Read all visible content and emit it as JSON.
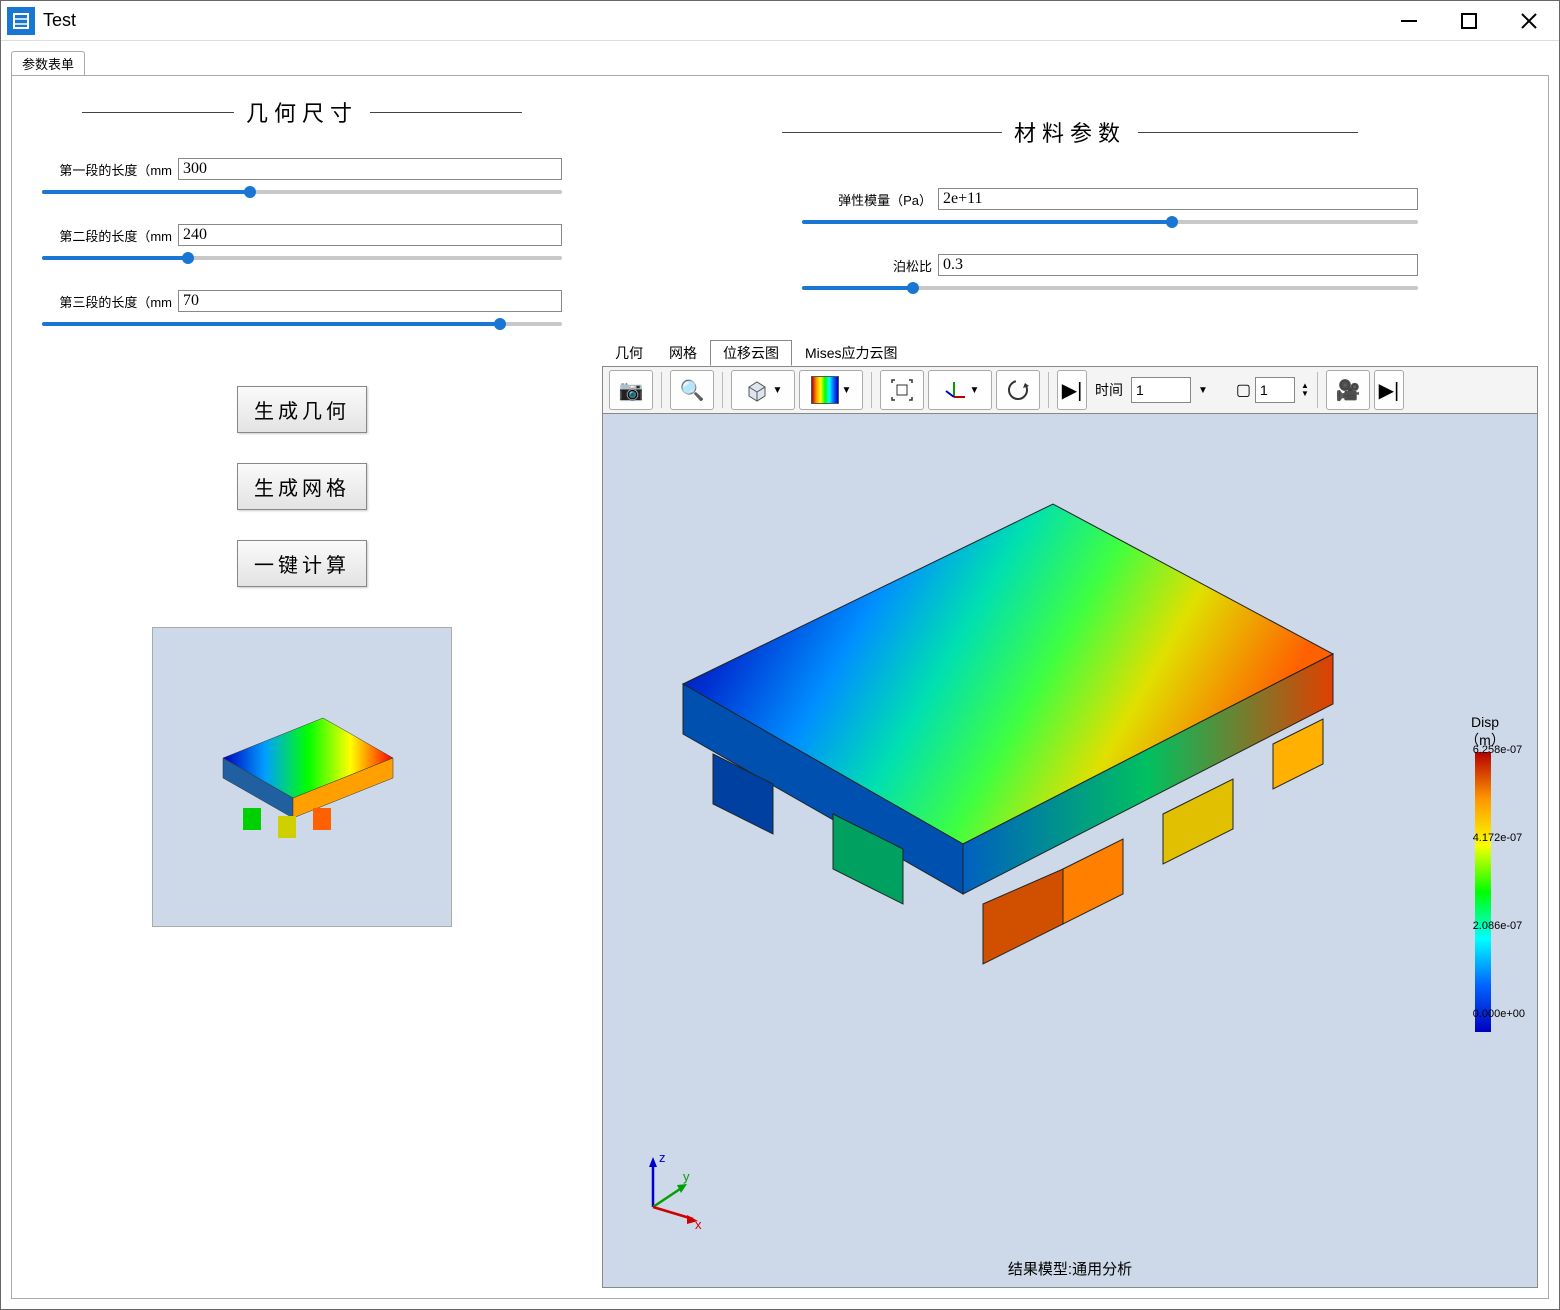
{
  "window": {
    "title": "Test"
  },
  "main_tab": "参数表单",
  "geometry_section": {
    "title": "几何尺寸",
    "params": [
      {
        "label": "第一段的长度（mm",
        "value": "300",
        "slider_pct": 40
      },
      {
        "label": "第二段的长度（mm",
        "value": "240",
        "slider_pct": 28
      },
      {
        "label": "第三段的长度（mm",
        "value": "70",
        "slider_pct": 88
      }
    ]
  },
  "material_section": {
    "title": "材料参数",
    "params": [
      {
        "label": "弹性模量（Pa）",
        "value": "2e+11",
        "slider_pct": 60
      },
      {
        "label": "泊松比",
        "value": "0.3",
        "slider_pct": 18
      }
    ]
  },
  "buttons": {
    "generate_geometry": "生成几何",
    "generate_mesh": "生成网格",
    "one_click_compute": "一键计算"
  },
  "viewer_tabs": [
    "几何",
    "网格",
    "位移云图",
    "Mises应力云图"
  ],
  "viewer_active_tab": 2,
  "toolbar": {
    "time_label": "时间",
    "time_value": "1",
    "frame_value": "1"
  },
  "colorbar": {
    "title1": "Disp",
    "title2": "（m）",
    "ticks": [
      "6.258e-07",
      "4.172e-07",
      "2.086e-07",
      "0.000e+00"
    ]
  },
  "caption": "结果模型:通用分析",
  "axes": {
    "x": "x",
    "y": "y",
    "z": "z"
  }
}
